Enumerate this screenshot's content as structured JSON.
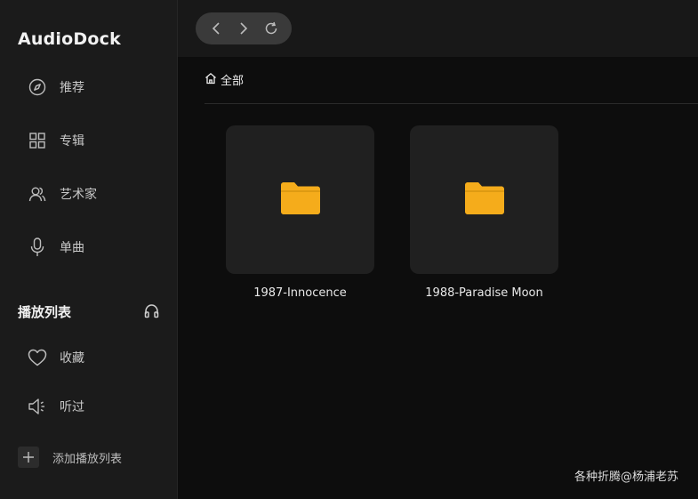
{
  "app": {
    "title": "AudioDock"
  },
  "sidebar": {
    "nav": [
      {
        "label": "推荐",
        "icon": "compass-icon"
      },
      {
        "label": "专辑",
        "icon": "grid-icon"
      },
      {
        "label": "艺术家",
        "icon": "users-icon"
      },
      {
        "label": "单曲",
        "icon": "microphone-icon"
      }
    ],
    "playlists_title": "播放列表",
    "playlists_icon": "headphones-icon",
    "playlists": [
      {
        "label": "收藏",
        "icon": "heart-icon"
      },
      {
        "label": "听过",
        "icon": "speaker-icon"
      }
    ],
    "add_playlist_label": "添加播放列表"
  },
  "topbar": {
    "buttons": [
      "back-icon",
      "forward-icon",
      "refresh-icon"
    ]
  },
  "breadcrumb": {
    "label": "全部",
    "icon": "home-icon"
  },
  "folders": [
    {
      "name": "1987-Innocence"
    },
    {
      "name": "1988-Paradise Moon"
    }
  ],
  "colors": {
    "sidebar_bg": "#1b1b1b",
    "main_bg": "#0d0d0d",
    "card_bg": "#202020",
    "folder_accent": "#f5ac1b"
  },
  "watermark": "各种折腾@杨浦老苏"
}
